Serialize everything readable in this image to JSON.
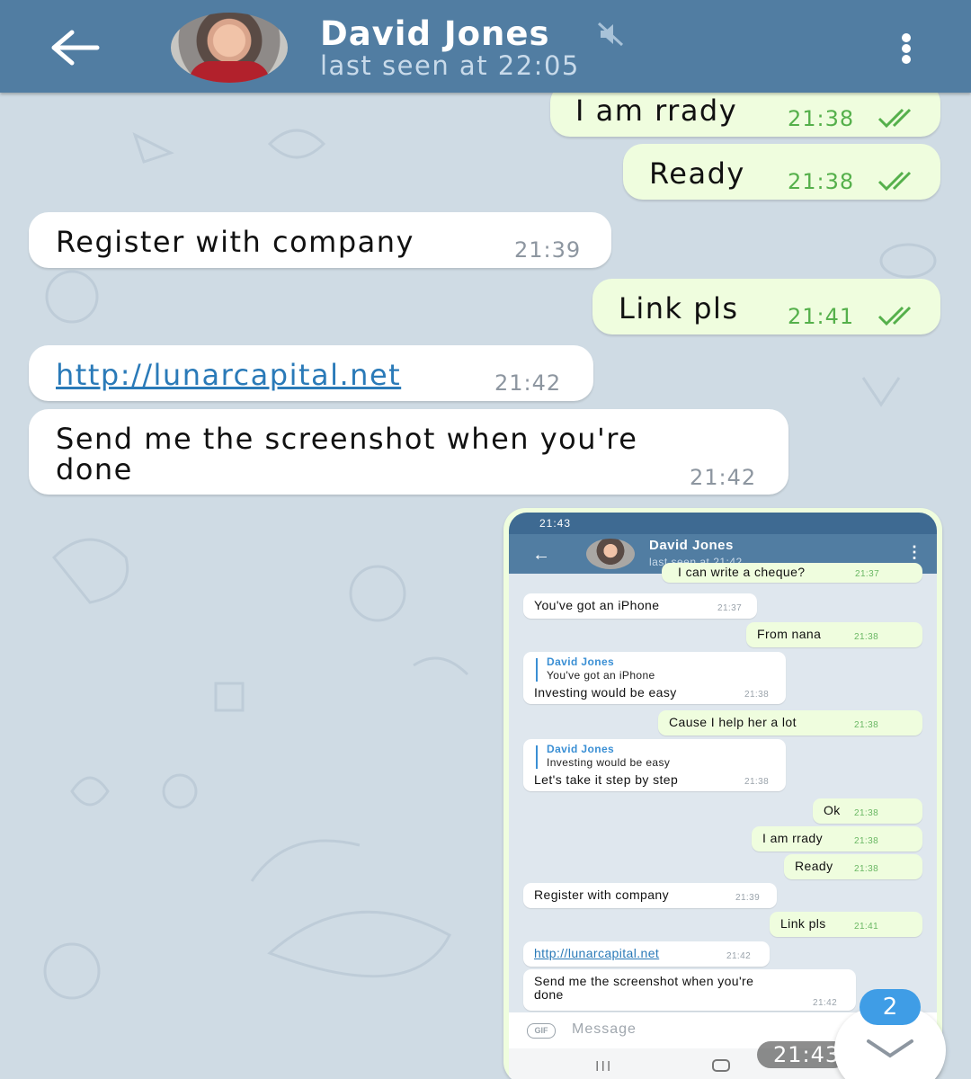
{
  "header": {
    "contact_name": "David Jones",
    "last_seen": "last seen at 22:05",
    "icons": {
      "back": "arrow-left-icon",
      "mute": "speaker-muted-icon",
      "menu": "dots-vertical-icon"
    }
  },
  "messages": [
    {
      "direction": "out",
      "text": "I am rrady",
      "time": "21:38",
      "status": "read"
    },
    {
      "direction": "out",
      "text": "Ready",
      "time": "21:38",
      "status": "read"
    },
    {
      "direction": "in",
      "text": "Register with company",
      "time": "21:39"
    },
    {
      "direction": "out",
      "text": "Link pls",
      "time": "21:41",
      "status": "read"
    },
    {
      "direction": "in",
      "text": "http://lunarcapital.net",
      "time": "21:42",
      "is_link": true
    },
    {
      "direction": "in",
      "text_line1": "Send me the screenshot when you're",
      "text_line2": "done",
      "time": "21:42"
    }
  ],
  "screenshot": {
    "status_time": "21:43",
    "contact_name": "David Jones",
    "last_seen": "last seen at 21:42",
    "messages": [
      {
        "direction": "out",
        "text": "I can write a cheque?",
        "time": "21:37"
      },
      {
        "direction": "in",
        "text": "You've got an iPhone",
        "time": "21:37"
      },
      {
        "direction": "out",
        "text": "From nana",
        "time": "21:38"
      },
      {
        "direction": "in",
        "reply_name": "David Jones",
        "reply_text": "You've got an iPhone",
        "text": "Investing would be easy",
        "time": "21:38"
      },
      {
        "direction": "out",
        "text": "Cause I help her a lot",
        "time": "21:38"
      },
      {
        "direction": "in",
        "reply_name": "David Jones",
        "reply_text": "Investing would be easy",
        "text": "Let's take it step by step",
        "time": "21:38"
      },
      {
        "direction": "out",
        "text": "Ok",
        "time": "21:38"
      },
      {
        "direction": "out",
        "text": "I am rrady",
        "time": "21:38"
      },
      {
        "direction": "out",
        "text": "Ready",
        "time": "21:38"
      },
      {
        "direction": "in",
        "text": "Register with company",
        "time": "21:39"
      },
      {
        "direction": "out",
        "text": "Link pls",
        "time": "21:41"
      },
      {
        "direction": "in",
        "text": "http://lunarcapital.net",
        "time": "21:42"
      },
      {
        "direction": "in",
        "text_line1": "Send me the screenshot when you're",
        "text_line2": "done",
        "time": "21:42"
      }
    ],
    "input_placeholder": "Message",
    "gif_label": "GIF",
    "nav_recents": "III",
    "image_time": "21:43"
  },
  "scroll_down": {
    "unread_count": "2"
  },
  "colors": {
    "header": "#517da2",
    "outgoing_bubble": "#effdde",
    "incoming_bubble": "#ffffff",
    "background": "#cfdbe4",
    "read_ticks": "#55b04b",
    "link": "#2a7ab8",
    "badge": "#3f9de6"
  }
}
